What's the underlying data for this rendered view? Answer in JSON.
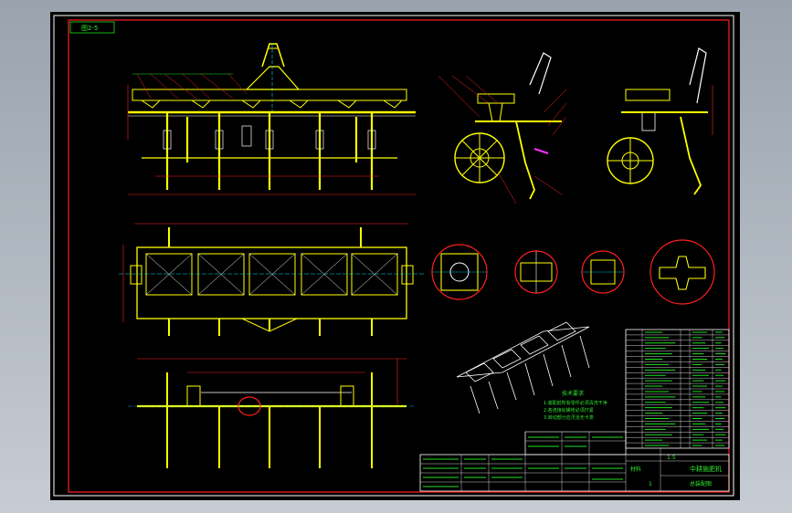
{
  "drawing": {
    "tag_label": "图2-5",
    "annotation_title": "技术要求",
    "annotation_lines": [
      "1.装配前所有零件必须清洗干净",
      "2.各连接处螺栓必须拧紧",
      "3.转动部分应灵活无卡滞"
    ]
  },
  "title_block": {
    "title": "中耕施肥机",
    "subtitle": "总装配图",
    "scale": "1:5",
    "sheet": "1",
    "material_label": "材料"
  },
  "bom": {
    "row_count": 22
  },
  "colors": {
    "frame": "#ff2020",
    "part": "#ffff00",
    "text": "#2ee82e",
    "outline": "#ffffff",
    "center": "#00e0ff",
    "background": "#000000"
  }
}
